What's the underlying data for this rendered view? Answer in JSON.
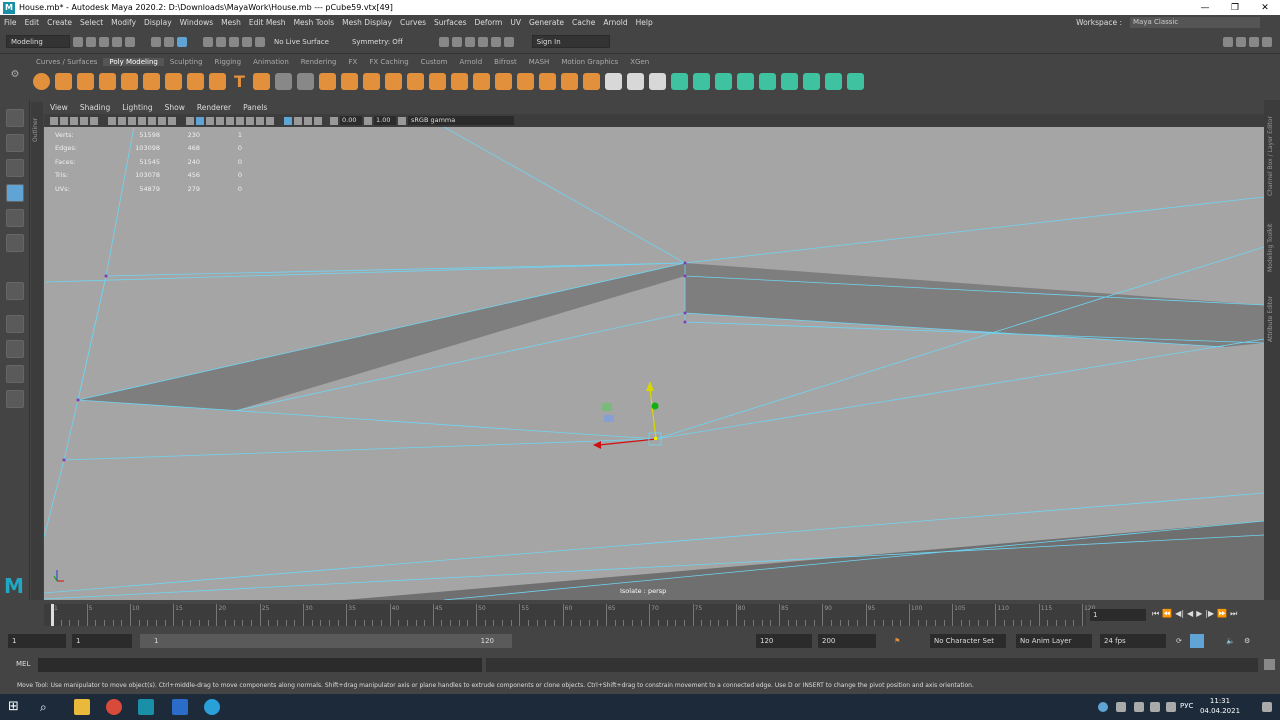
{
  "titlebar": {
    "text": "House.mb* - Autodesk Maya 2020.2: D:\\Downloads\\MayaWork\\House.mb   ---   pCube59.vtx[49]",
    "logo": "M"
  },
  "menus": [
    "File",
    "Edit",
    "Create",
    "Select",
    "Modify",
    "Display",
    "Windows",
    "Mesh",
    "Edit Mesh",
    "Mesh Tools",
    "Mesh Display",
    "Curves",
    "Surfaces",
    "Deform",
    "UV",
    "Generate",
    "Cache",
    "Arnold",
    "Help"
  ],
  "workspace": {
    "label": "Workspace :",
    "value": "Maya Classic"
  },
  "statusline": {
    "mode": "Modeling",
    "live_surface": "No Live Surface",
    "symmetry": "Symmetry: Off",
    "sign_in": "Sign In"
  },
  "shelf_tabs": [
    "Curves / Surfaces",
    "Poly Modeling",
    "Sculpting",
    "Rigging",
    "Animation",
    "Rendering",
    "FX",
    "FX Caching",
    "Custom",
    "Arnold",
    "Bifrost",
    "MASH",
    "Motion Graphics",
    "XGen"
  ],
  "shelf_active": "Poly Modeling",
  "panel_menu": [
    "View",
    "Shading",
    "Lighting",
    "Show",
    "Renderer",
    "Panels"
  ],
  "panel_toolbar": {
    "exposure": "0.00",
    "gamma": "1.00",
    "colorspace": "sRGB gamma"
  },
  "outliner_tab": "Outliner",
  "hud": [
    {
      "label": "Verts:",
      "v1": "51598",
      "v2": "230",
      "v3": "1"
    },
    {
      "label": "Edges:",
      "v1": "103098",
      "v2": "468",
      "v3": "0"
    },
    {
      "label": "Faces:",
      "v1": "51545",
      "v2": "240",
      "v3": "0"
    },
    {
      "label": "Tris:",
      "v1": "103078",
      "v2": "456",
      "v3": "0"
    },
    {
      "label": "UVs:",
      "v1": "54879",
      "v2": "279",
      "v3": "0"
    }
  ],
  "camera_label": "Isolate : persp",
  "right_tabs": [
    "Channel Box / Layer Editor",
    "Modeling Toolkit",
    "Attribute Editor"
  ],
  "timeline": {
    "ticks": [
      "1",
      "5",
      "10",
      "15",
      "20",
      "25",
      "30",
      "35",
      "40",
      "45",
      "50",
      "55",
      "60",
      "65",
      "70",
      "75",
      "80",
      "85",
      "90",
      "95",
      "100",
      "105",
      "110",
      "115",
      "120"
    ],
    "current_frame": "1"
  },
  "range": {
    "start": "1",
    "playback_start": "1",
    "slider_start": "1",
    "slider_end": "120",
    "playback_end": "120",
    "end": "200",
    "character_set": "No Character Set",
    "anim_layer": "No Anim Layer",
    "fps": "24 fps"
  },
  "mel": {
    "label": "MEL"
  },
  "help_line": "Move Tool: Use manipulator to move object(s). Ctrl+middle-drag to move components along normals. Shift+drag manipulator axis or plane handles to extrude components or clone objects. Ctrl+Shift+drag to constrain movement to a connected edge. Use D or INSERT to change the pivot position and axis orientation.",
  "taskbar": {
    "lang": "РУС",
    "time": "11:31",
    "date": "04.04.2021"
  },
  "colors": {
    "accent_orange": "#e3903d",
    "accent_teal": "#3ec2a0",
    "wire_blue": "#5fd0f0",
    "viewport_bg": "#a5a5a5"
  }
}
